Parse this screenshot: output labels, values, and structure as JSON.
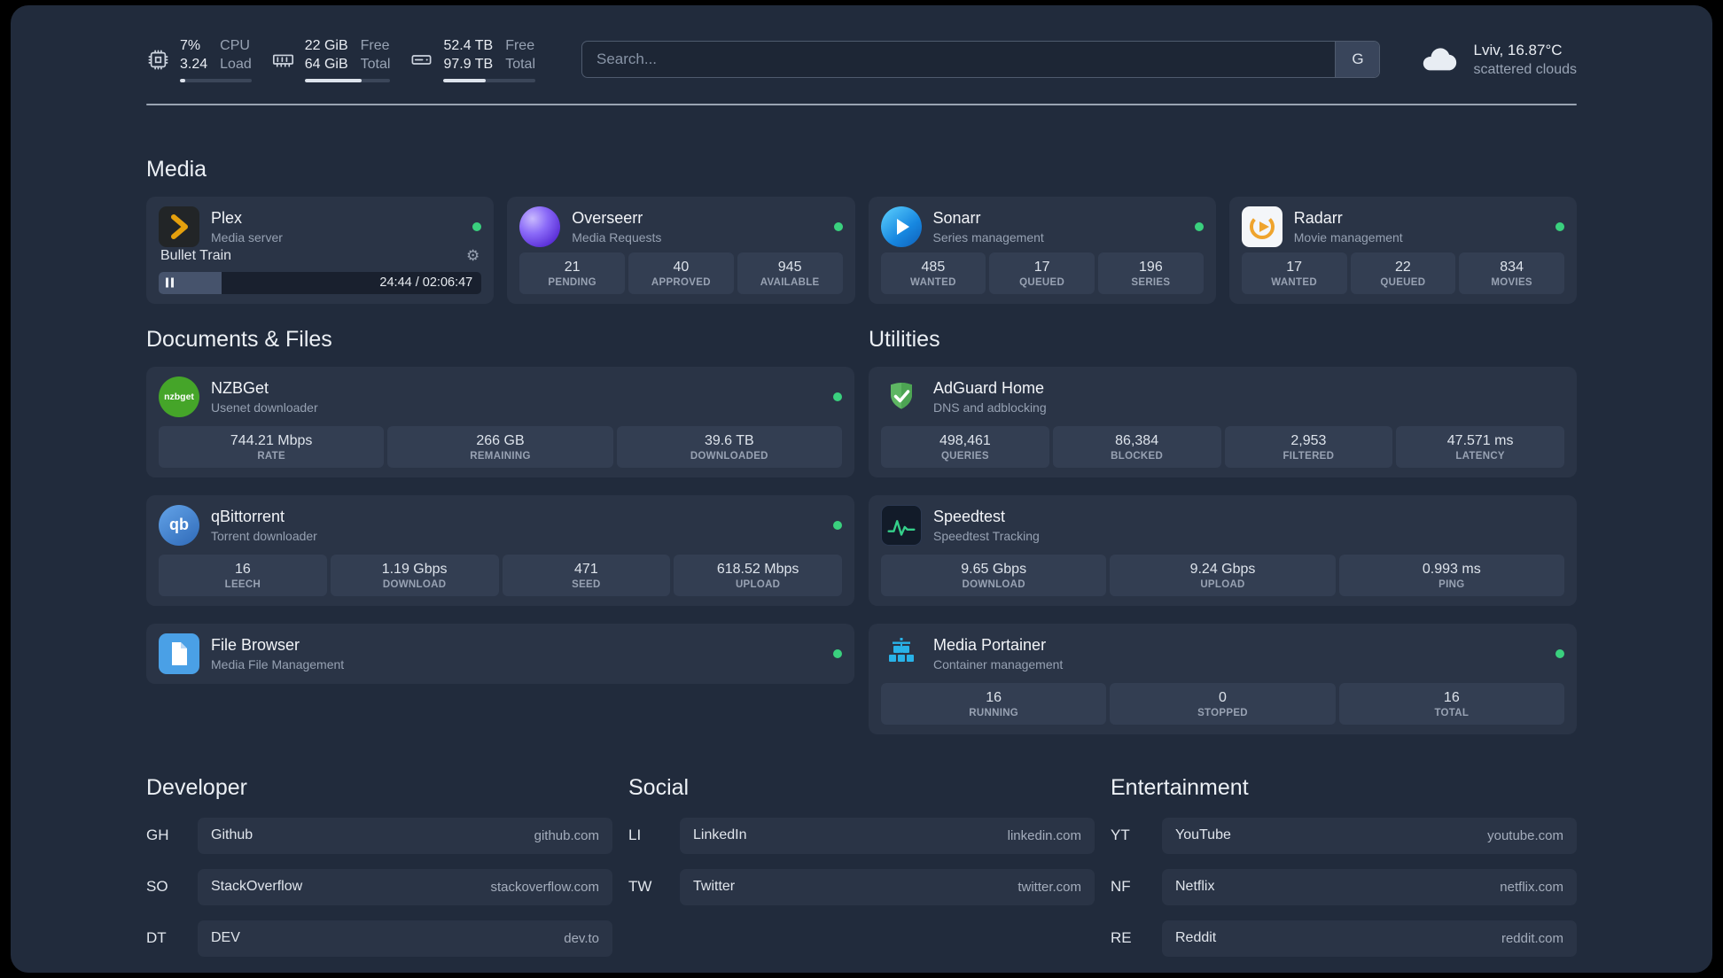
{
  "topbar": {
    "resources": [
      {
        "icon": "cpu-icon",
        "value1": "7%",
        "value2": "3.24",
        "label1": "CPU",
        "label2": "Load",
        "percent": 7
      },
      {
        "icon": "memory-icon",
        "value1": "22 GiB",
        "value2": "64 GiB",
        "label1": "Free",
        "label2": "Total",
        "percent": 66
      },
      {
        "icon": "disk-icon",
        "value1": "52.4 TB",
        "value2": "97.9 TB",
        "label1": "Free",
        "label2": "Total",
        "percent": 46
      }
    ],
    "search": {
      "placeholder": "Search...",
      "button_label": "G"
    },
    "weather": {
      "location": "Lviv, 16.87°C",
      "condition": "scattered clouds"
    }
  },
  "section_titles": {
    "media": "Media",
    "documents": "Documents & Files",
    "utilities": "Utilities",
    "developer": "Developer",
    "social": "Social",
    "entertainment": "Entertainment"
  },
  "icons": {
    "gear": "⚙"
  },
  "services": {
    "plex": {
      "name": "Plex",
      "desc": "Media server",
      "track": "Bullet Train",
      "time": "24:44 / 02:06:47",
      "progress_percent": 19.6
    },
    "overseerr": {
      "name": "Overseerr",
      "desc": "Media Requests",
      "stats": [
        {
          "value": "21",
          "label": "PENDING"
        },
        {
          "value": "40",
          "label": "APPROVED"
        },
        {
          "value": "945",
          "label": "AVAILABLE"
        }
      ]
    },
    "sonarr": {
      "name": "Sonarr",
      "desc": "Series management",
      "stats": [
        {
          "value": "485",
          "label": "WANTED"
        },
        {
          "value": "17",
          "label": "QUEUED"
        },
        {
          "value": "196",
          "label": "SERIES"
        }
      ]
    },
    "radarr": {
      "name": "Radarr",
      "desc": "Movie management",
      "stats": [
        {
          "value": "17",
          "label": "WANTED"
        },
        {
          "value": "22",
          "label": "QUEUED"
        },
        {
          "value": "834",
          "label": "MOVIES"
        }
      ]
    },
    "nzbget": {
      "name": "NZBGet",
      "desc": "Usenet downloader",
      "icon_text": "nzbget",
      "stats": [
        {
          "value": "744.21 Mbps",
          "label": "RATE"
        },
        {
          "value": "266 GB",
          "label": "REMAINING"
        },
        {
          "value": "39.6 TB",
          "label": "DOWNLOADED"
        }
      ]
    },
    "qbittorrent": {
      "name": "qBittorrent",
      "desc": "Torrent downloader",
      "icon_text": "qb",
      "stats": [
        {
          "value": "16",
          "label": "LEECH"
        },
        {
          "value": "1.19 Gbps",
          "label": "DOWNLOAD"
        },
        {
          "value": "471",
          "label": "SEED"
        },
        {
          "value": "618.52 Mbps",
          "label": "UPLOAD"
        }
      ]
    },
    "filebrowser": {
      "name": "File Browser",
      "desc": "Media File Management"
    },
    "adguard": {
      "name": "AdGuard Home",
      "desc": "DNS and adblocking",
      "stats": [
        {
          "value": "498,461",
          "label": "QUERIES"
        },
        {
          "value": "86,384",
          "label": "BLOCKED"
        },
        {
          "value": "2,953",
          "label": "FILTERED"
        },
        {
          "value": "47.571 ms",
          "label": "LATENCY"
        }
      ]
    },
    "speedtest": {
      "name": "Speedtest",
      "desc": "Speedtest Tracking",
      "stats": [
        {
          "value": "9.65 Gbps",
          "label": "DOWNLOAD"
        },
        {
          "value": "9.24 Gbps",
          "label": "UPLOAD"
        },
        {
          "value": "0.993 ms",
          "label": "PING"
        }
      ]
    },
    "portainer": {
      "name": "Media Portainer",
      "desc": "Container management",
      "stats": [
        {
          "value": "16",
          "label": "RUNNING"
        },
        {
          "value": "0",
          "label": "STOPPED"
        },
        {
          "value": "16",
          "label": "TOTAL"
        }
      ]
    }
  },
  "bookmarks": {
    "developer": [
      {
        "abbr": "GH",
        "name": "Github",
        "domain": "github.com"
      },
      {
        "abbr": "SO",
        "name": "StackOverflow",
        "domain": "stackoverflow.com"
      },
      {
        "abbr": "DT",
        "name": "DEV",
        "domain": "dev.to"
      }
    ],
    "social": [
      {
        "abbr": "LI",
        "name": "LinkedIn",
        "domain": "linkedin.com"
      },
      {
        "abbr": "TW",
        "name": "Twitter",
        "domain": "twitter.com"
      }
    ],
    "entertainment": [
      {
        "abbr": "YT",
        "name": "YouTube",
        "domain": "youtube.com"
      },
      {
        "abbr": "NF",
        "name": "Netflix",
        "domain": "netflix.com"
      },
      {
        "abbr": "RE",
        "name": "Reddit",
        "domain": "reddit.com"
      }
    ]
  },
  "colors": {
    "status_online": "#3ad07e",
    "plex_amber": "#e5a00d",
    "radarr_amber": "#efa42d",
    "overseerr_purple": "#8b6bf8",
    "sonarr_blue": "#1787e0",
    "nzbget_green": "#45a529",
    "qbittorrent_blue": "#2f6ab8",
    "adguard_green": "#5eb663",
    "speedtest_green": "#35d08a",
    "portainer_blue": "#29b2e8",
    "filebrowser_blue": "#4aa0e6"
  }
}
